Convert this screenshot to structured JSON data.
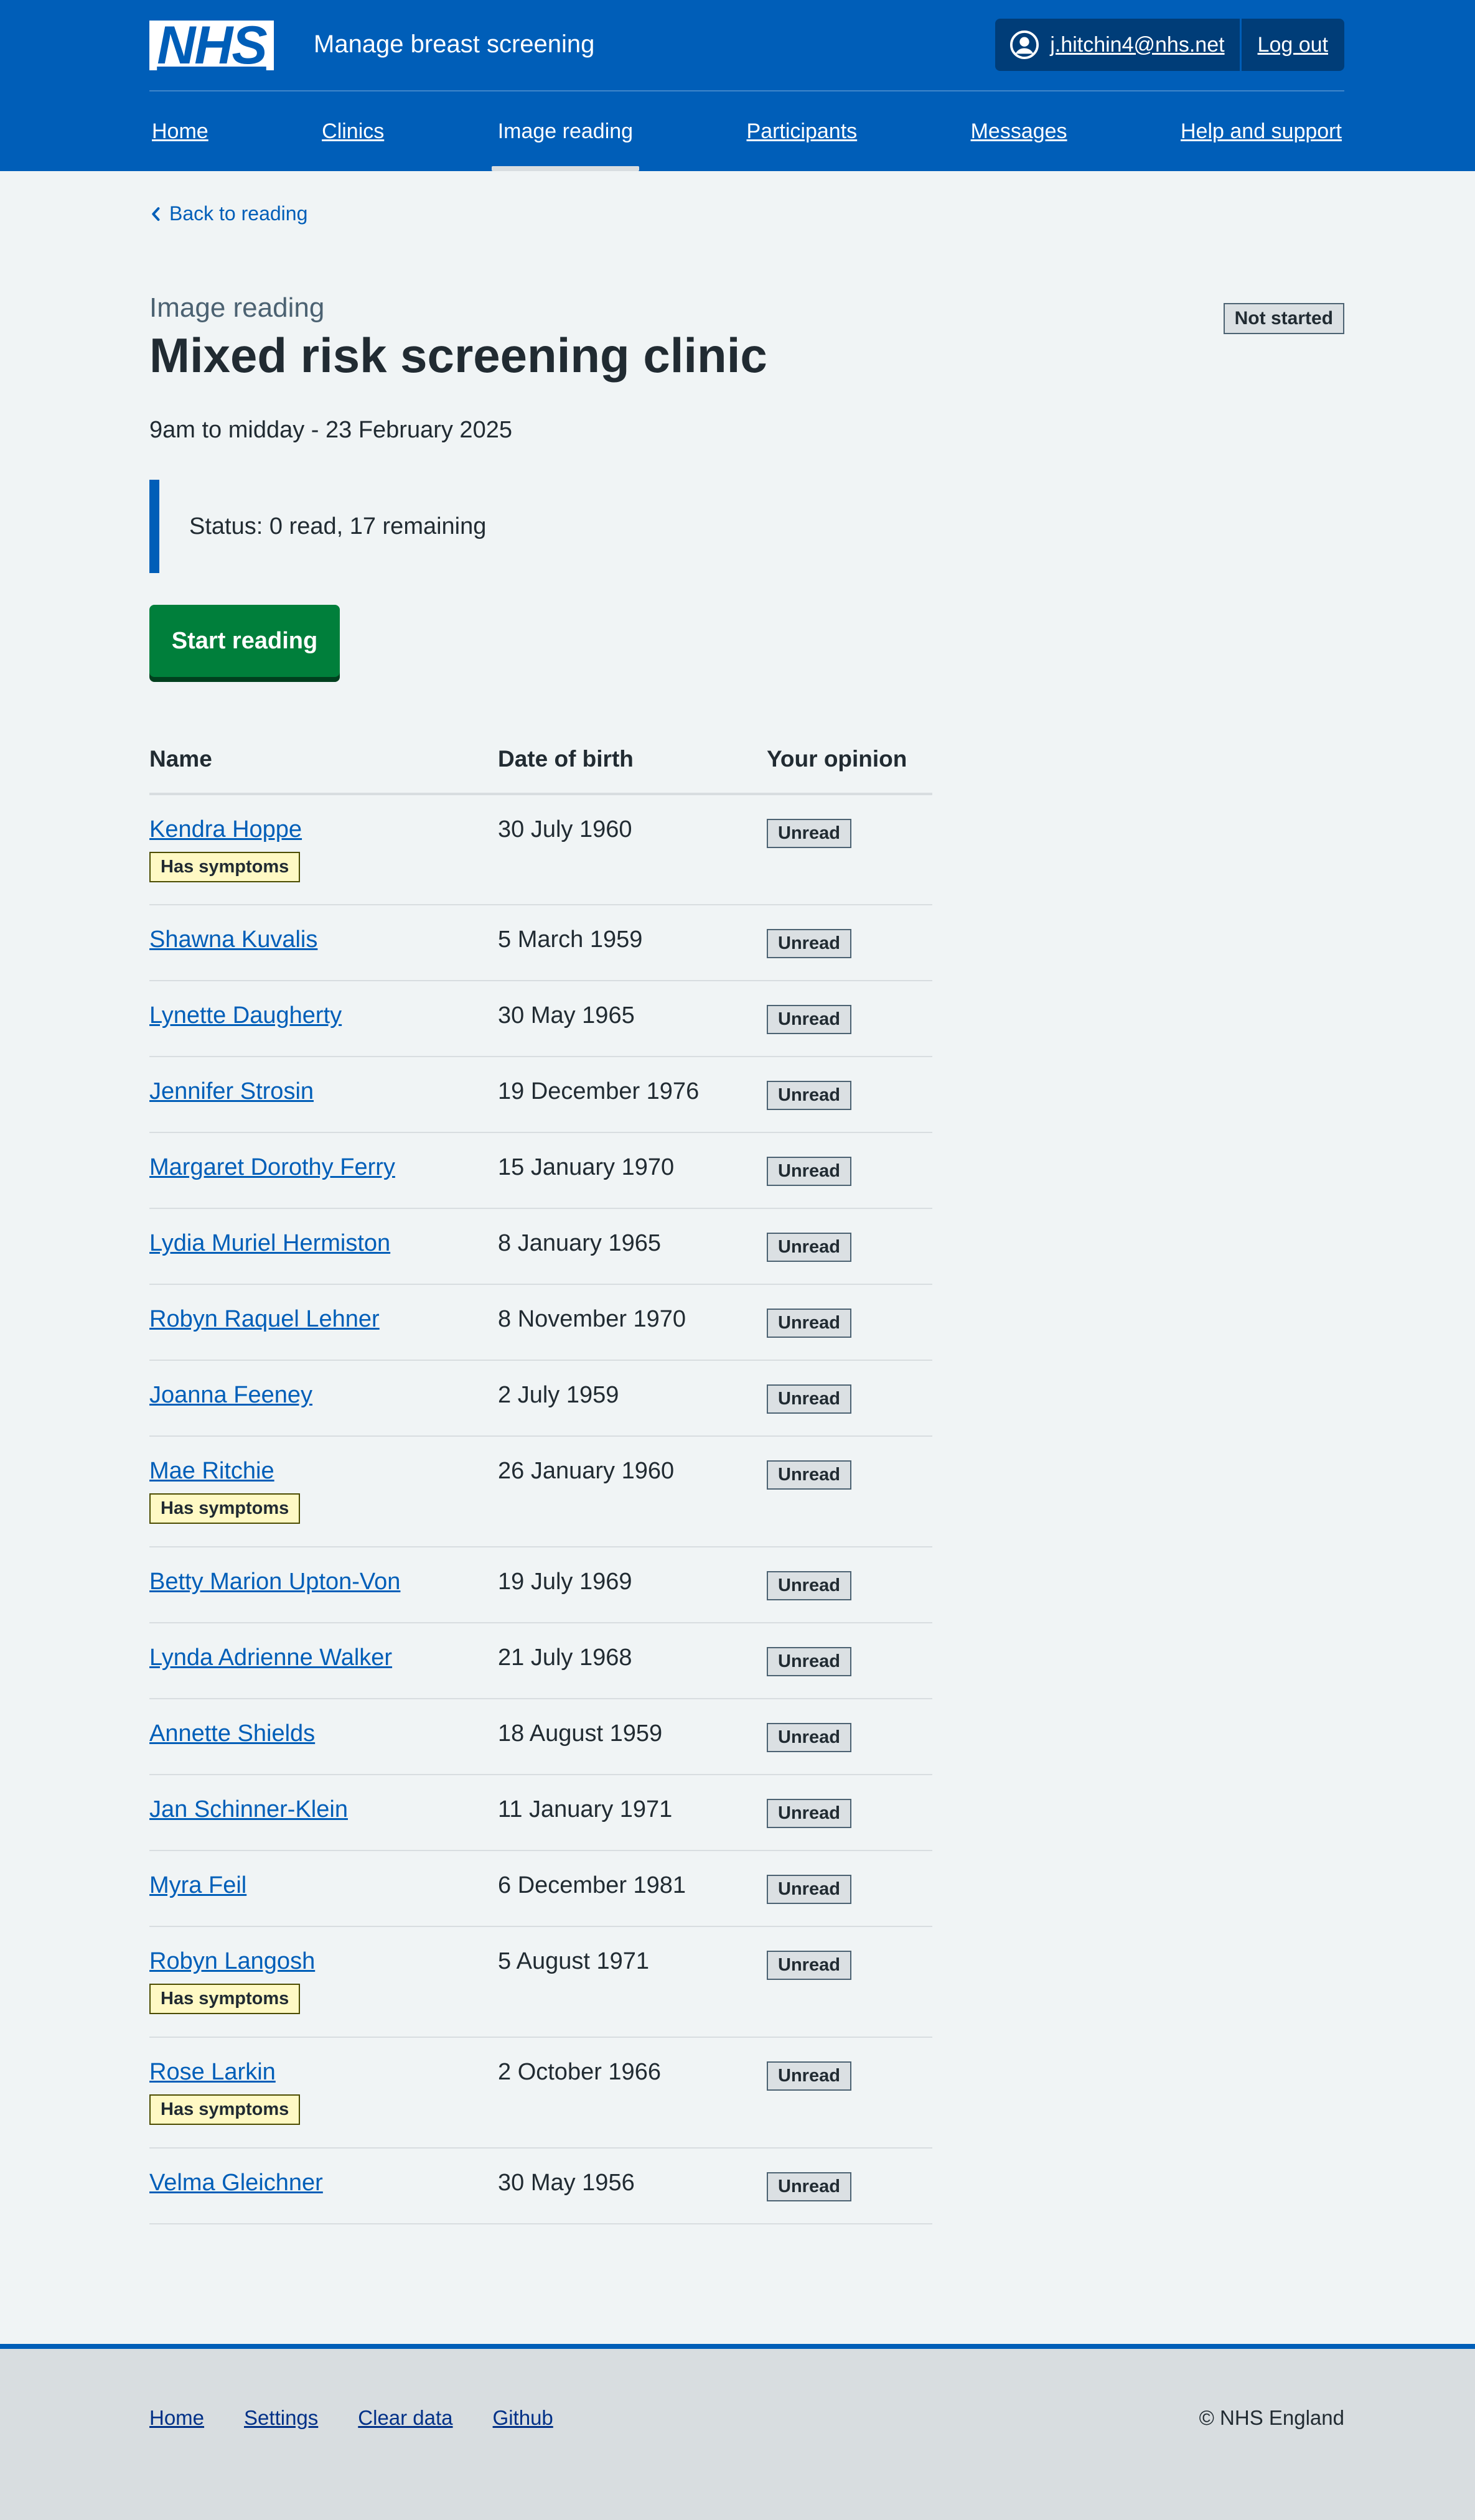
{
  "header": {
    "logo_text": "NHS",
    "service_name": "Manage breast screening",
    "account_email": "j.hitchin4@nhs.net",
    "logout_label": "Log out",
    "icons": {
      "user": "user-circle-icon"
    }
  },
  "nav": {
    "items": [
      {
        "label": "Home"
      },
      {
        "label": "Clinics"
      },
      {
        "label": "Image reading",
        "current": true
      },
      {
        "label": "Participants"
      },
      {
        "label": "Messages"
      },
      {
        "label": "Help and support"
      }
    ]
  },
  "main": {
    "back_link": "Back to reading",
    "caption": "Image reading",
    "title": "Mixed risk screening clinic",
    "status_tag": "Not started",
    "clinic_time": "9am to midday - 23 February 2025",
    "status_text": "Status: 0 read, 17 remaining",
    "start_button": "Start reading"
  },
  "table": {
    "headers": {
      "name": "Name",
      "dob": "Date of birth",
      "opinion": "Your opinion"
    },
    "symptom_label": "Has symptoms",
    "rows": [
      {
        "name": "Kendra Hoppe",
        "dob": "30 July 1960",
        "opinion": "Unread",
        "symptoms": true
      },
      {
        "name": "Shawna Kuvalis",
        "dob": "5 March 1959",
        "opinion": "Unread",
        "symptoms": false
      },
      {
        "name": "Lynette Daugherty",
        "dob": "30 May 1965",
        "opinion": "Unread",
        "symptoms": false
      },
      {
        "name": "Jennifer Strosin",
        "dob": "19 December 1976",
        "opinion": "Unread",
        "symptoms": false
      },
      {
        "name": "Margaret Dorothy Ferry",
        "dob": "15 January 1970",
        "opinion": "Unread",
        "symptoms": false
      },
      {
        "name": "Lydia Muriel Hermiston",
        "dob": "8 January 1965",
        "opinion": "Unread",
        "symptoms": false
      },
      {
        "name": "Robyn Raquel Lehner",
        "dob": "8 November 1970",
        "opinion": "Unread",
        "symptoms": false
      },
      {
        "name": "Joanna Feeney",
        "dob": "2 July 1959",
        "opinion": "Unread",
        "symptoms": false
      },
      {
        "name": "Mae Ritchie",
        "dob": "26 January 1960",
        "opinion": "Unread",
        "symptoms": true
      },
      {
        "name": "Betty Marion Upton-Von",
        "dob": "19 July 1969",
        "opinion": "Unread",
        "symptoms": false
      },
      {
        "name": "Lynda Adrienne Walker",
        "dob": "21 July 1968",
        "opinion": "Unread",
        "symptoms": false
      },
      {
        "name": "Annette Shields",
        "dob": "18 August 1959",
        "opinion": "Unread",
        "symptoms": false
      },
      {
        "name": "Jan Schinner-Klein",
        "dob": "11 January 1971",
        "opinion": "Unread",
        "symptoms": false
      },
      {
        "name": "Myra Feil",
        "dob": "6 December 1981",
        "opinion": "Unread",
        "symptoms": false
      },
      {
        "name": "Robyn Langosh",
        "dob": "5 August 1971",
        "opinion": "Unread",
        "symptoms": true
      },
      {
        "name": "Rose Larkin",
        "dob": "2 October 1966",
        "opinion": "Unread",
        "symptoms": true
      },
      {
        "name": "Velma Gleichner",
        "dob": "30 May 1956",
        "opinion": "Unread",
        "symptoms": false
      }
    ]
  },
  "footer": {
    "links": [
      "Home",
      "Settings",
      "Clear data",
      "Github"
    ],
    "copyright": "© NHS England"
  },
  "colors": {
    "nhs_blue": "#005eb8",
    "dark_blue": "#003d78",
    "green": "#007f3b",
    "background": "#f0f4f5",
    "text": "#212b32",
    "yellow_tag": "#fff9c4",
    "grey_tag": "#dbe0e3"
  }
}
